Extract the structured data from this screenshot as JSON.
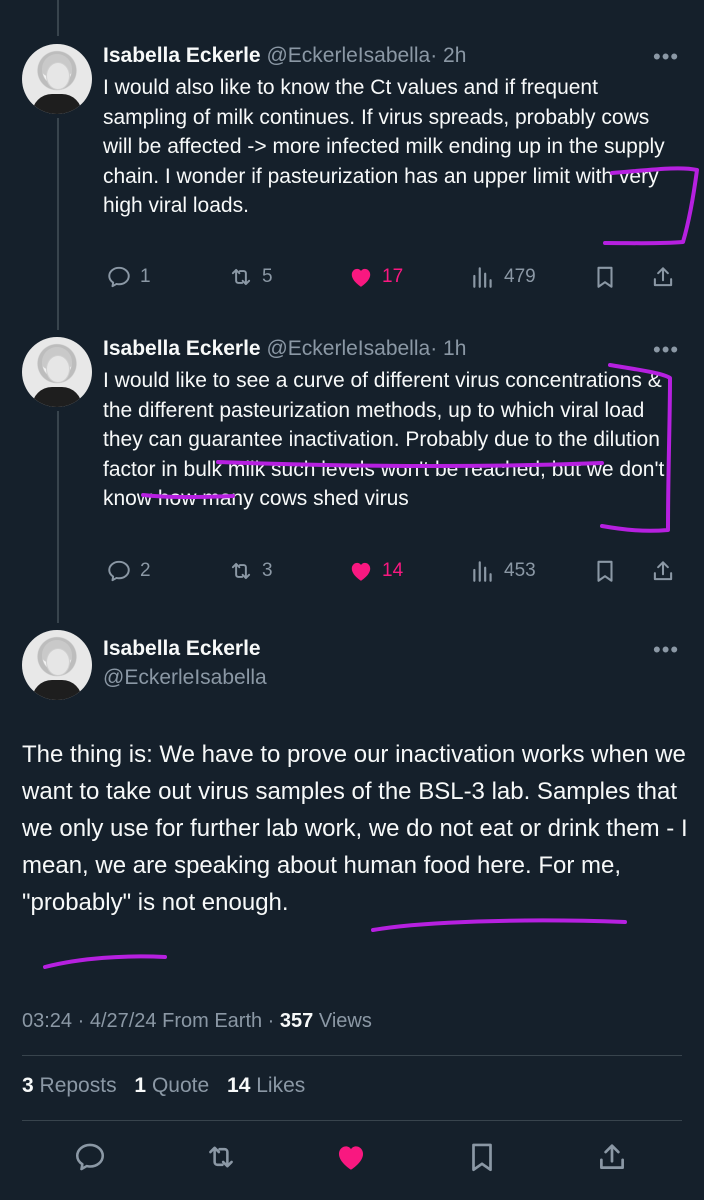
{
  "replies": [
    {
      "name": "Isabella Eckerle",
      "handle": "@EckerleIsabella",
      "time": "· 2h",
      "text": "I would also like to know the Ct values and if frequent sampling of milk continues. If virus spreads, probably  cows will be affected -> more infected milk ending up in the supply chain. I wonder if pasteurization has an upper limit with very high viral loads.",
      "replies": "1",
      "reposts": "5",
      "likes": "17",
      "views": "479"
    },
    {
      "name": "Isabella Eckerle",
      "handle": "@EckerleIsabella",
      "time": "· 1h",
      "text": "I would like to see a curve of different virus concentrations & the different pasteurization methods, up to which viral load they can guarantee inactivation. Probably due to the dilution factor in bulk milk such levels won't be reached, but we don't know how many cows shed virus",
      "replies": "2",
      "reposts": "3",
      "likes": "14",
      "views": "453"
    }
  ],
  "main": {
    "name": "Isabella Eckerle",
    "handle": "@EckerleIsabella",
    "text": "The thing is: We have to prove our inactivation works when we want to take out virus samples of the BSL-3 lab. Samples that we only use for further lab work, we do not eat or drink them -  I mean, we are speaking about human food here. For me, \"probably\" is not enough.",
    "time": "03:24 · 4/27/24 From Earth ·",
    "views_count": "357",
    "views_label": "Views",
    "reposts_count": "3",
    "reposts_label": "Reposts",
    "quotes_count": "1",
    "quotes_label": "Quote",
    "likes_count": "14",
    "likes_label": "Likes"
  },
  "more_glyph": "•••",
  "colors": {
    "background": "#15202b",
    "text": "#f7f9f9",
    "muted": "#8b98a5",
    "like": "#f91880",
    "annotation": "#b620e0"
  },
  "icons": [
    "reply-icon",
    "repost-icon",
    "heart-icon",
    "views-icon",
    "bookmark-icon",
    "share-icon"
  ]
}
